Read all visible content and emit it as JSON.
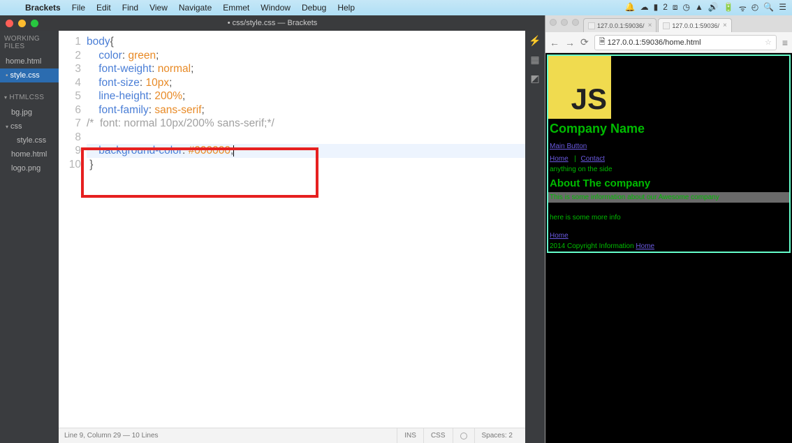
{
  "menubar": {
    "app": "Brackets",
    "items": [
      "File",
      "Edit",
      "Find",
      "View",
      "Navigate",
      "Emmet",
      "Window",
      "Debug",
      "Help"
    ]
  },
  "brackets": {
    "title": "• css/style.css — Brackets",
    "sidebar": {
      "working_head": "Working Files",
      "working": [
        {
          "name": "home.html",
          "active": false,
          "dirty": false
        },
        {
          "name": "style.css",
          "active": true,
          "dirty": true
        }
      ],
      "project_head": "htmlcss",
      "tree": [
        {
          "name": "bg.jpg",
          "indent": 1
        },
        {
          "name": "css",
          "indent": 0,
          "expandable": true
        },
        {
          "name": "style.css",
          "indent": 2
        },
        {
          "name": "home.html",
          "indent": 1
        },
        {
          "name": "logo.png",
          "indent": 1
        }
      ]
    },
    "code_lines": [
      {
        "n": 1,
        "tokens": [
          [
            "sel",
            "body"
          ],
          [
            "punc",
            "{"
          ]
        ]
      },
      {
        "n": 2,
        "tokens": [
          [
            "plain",
            "    "
          ],
          [
            "prop",
            "color"
          ],
          [
            "punc",
            ": "
          ],
          [
            "val",
            "green"
          ],
          [
            "punc",
            ";"
          ]
        ]
      },
      {
        "n": 3,
        "tokens": [
          [
            "plain",
            "    "
          ],
          [
            "prop",
            "font-weight"
          ],
          [
            "punc",
            ": "
          ],
          [
            "val",
            "normal"
          ],
          [
            "punc",
            ";"
          ]
        ]
      },
      {
        "n": 4,
        "tokens": [
          [
            "plain",
            "    "
          ],
          [
            "prop",
            "font-size"
          ],
          [
            "punc",
            ": "
          ],
          [
            "val",
            "10px"
          ],
          [
            "punc",
            ";"
          ]
        ]
      },
      {
        "n": 5,
        "tokens": [
          [
            "plain",
            "    "
          ],
          [
            "prop",
            "line-height"
          ],
          [
            "punc",
            ": "
          ],
          [
            "val",
            "200%"
          ],
          [
            "punc",
            ";"
          ]
        ]
      },
      {
        "n": 6,
        "tokens": [
          [
            "plain",
            "    "
          ],
          [
            "prop",
            "font-family"
          ],
          [
            "punc",
            ": "
          ],
          [
            "val",
            "sans-serif"
          ],
          [
            "punc",
            ";"
          ]
        ]
      },
      {
        "n": 7,
        "tokens": [
          [
            "comment",
            "/*  font: normal 10px/200% sans-serif;*/"
          ]
        ]
      },
      {
        "n": 8,
        "tokens": [
          [
            "plain",
            ""
          ]
        ]
      },
      {
        "n": 9,
        "tokens": [
          [
            "plain",
            "    "
          ],
          [
            "prop",
            "background-color"
          ],
          [
            "punc",
            ": "
          ],
          [
            "val",
            "#000000"
          ],
          [
            "punc",
            ";"
          ]
        ],
        "hl": true,
        "cursor": true
      },
      {
        "n": 10,
        "tokens": [
          [
            "punc",
            " }"
          ]
        ]
      }
    ],
    "status": {
      "pos": "Line 9, Column 29 — 10 Lines",
      "ins": "INS",
      "lang": "CSS",
      "spaces": "Spaces: 2"
    }
  },
  "chrome": {
    "tabs": [
      {
        "label": "127.0.0.1:59036/",
        "active": false
      },
      {
        "label": "127.0.0.1:59036/",
        "active": true
      }
    ],
    "url": "127.0.0.1:59036/home.html",
    "page": {
      "logo": "JS",
      "h1": "Company Name",
      "main_button": "Main Button",
      "home": "Home",
      "sep": " | ",
      "contact": "Contact",
      "aside": "anything on the side",
      "h2": "About The company",
      "para1": "This is some information about our Awesome company",
      "para2": "here is some more info",
      "home2": "Home",
      "footer_prefix": "2014 Copyright Information ",
      "footer_link": "Home"
    }
  }
}
